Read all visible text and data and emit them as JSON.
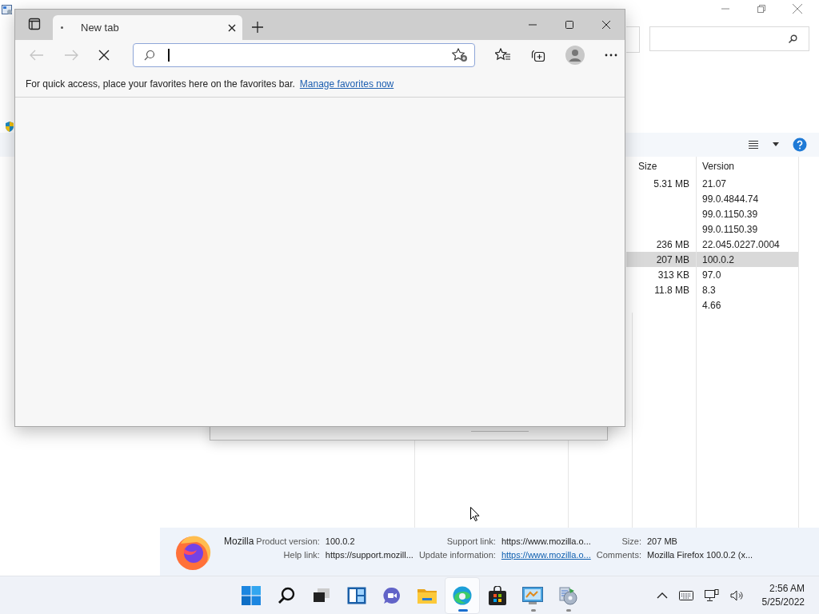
{
  "programs_window": {
    "table": {
      "columns": [
        "Size",
        "Version"
      ],
      "rows": [
        {
          "size": "5.31 MB",
          "version": "21.07",
          "selected": false
        },
        {
          "version": "99.0.4844.74",
          "selected": false
        },
        {
          "version": "99.0.1150.39",
          "selected": false
        },
        {
          "version": "99.0.1150.39",
          "selected": false
        },
        {
          "size": "236 MB",
          "version": "22.045.0227.0004",
          "selected": false
        },
        {
          "size": "207 MB",
          "version": "100.0.2",
          "selected": true
        },
        {
          "size": "313 KB",
          "version": "97.0",
          "selected": false
        },
        {
          "size": "11.8 MB",
          "version": "8.3",
          "selected": false
        },
        {
          "version": "4.66",
          "selected": false
        }
      ]
    },
    "details": {
      "name": "Mozilla",
      "fields": [
        {
          "label": "Product version:",
          "value": "100.0.2",
          "link": false
        },
        {
          "label": "Support link:",
          "value": "https://www.mozilla.o...",
          "link": false
        },
        {
          "label": "Size:",
          "value": "207 MB",
          "link": false
        },
        {
          "label": "Help link:",
          "value": "https://support.mozill...",
          "link": false
        },
        {
          "label": "Update information:",
          "value": "https://www.mozilla.o...",
          "link": true
        },
        {
          "label": "Comments:",
          "value": "Mozilla Firefox 100.0.2 (x...",
          "link": false
        }
      ]
    }
  },
  "browser": {
    "tabs": [
      {
        "title": "New tab",
        "selected": true
      }
    ],
    "nav": [
      {
        "kind": "back",
        "disabled": true
      },
      {
        "kind": "forward",
        "disabled": true
      },
      {
        "kind": "stop",
        "disabled": false
      }
    ],
    "favorites_bar": {
      "message": "For quick access, place your favorites here on the favorites bar.",
      "link": "Manage favorites now"
    }
  },
  "taskbar": {
    "apps": [
      {
        "kind": "start",
        "running": false,
        "active": false
      },
      {
        "kind": "search",
        "running": false,
        "active": false
      },
      {
        "kind": "taskview",
        "running": false,
        "active": false
      },
      {
        "kind": "widgets",
        "running": false,
        "active": false
      },
      {
        "kind": "chat",
        "running": false,
        "active": false
      },
      {
        "kind": "explorer",
        "running": false,
        "active": false
      },
      {
        "kind": "edge",
        "running": true,
        "active": true
      },
      {
        "kind": "store",
        "running": false,
        "active": false
      },
      {
        "kind": "control",
        "running": true,
        "active": false
      },
      {
        "kind": "programs",
        "running": true,
        "active": false
      }
    ],
    "time": "2:56 AM",
    "date": "5/25/2022"
  }
}
